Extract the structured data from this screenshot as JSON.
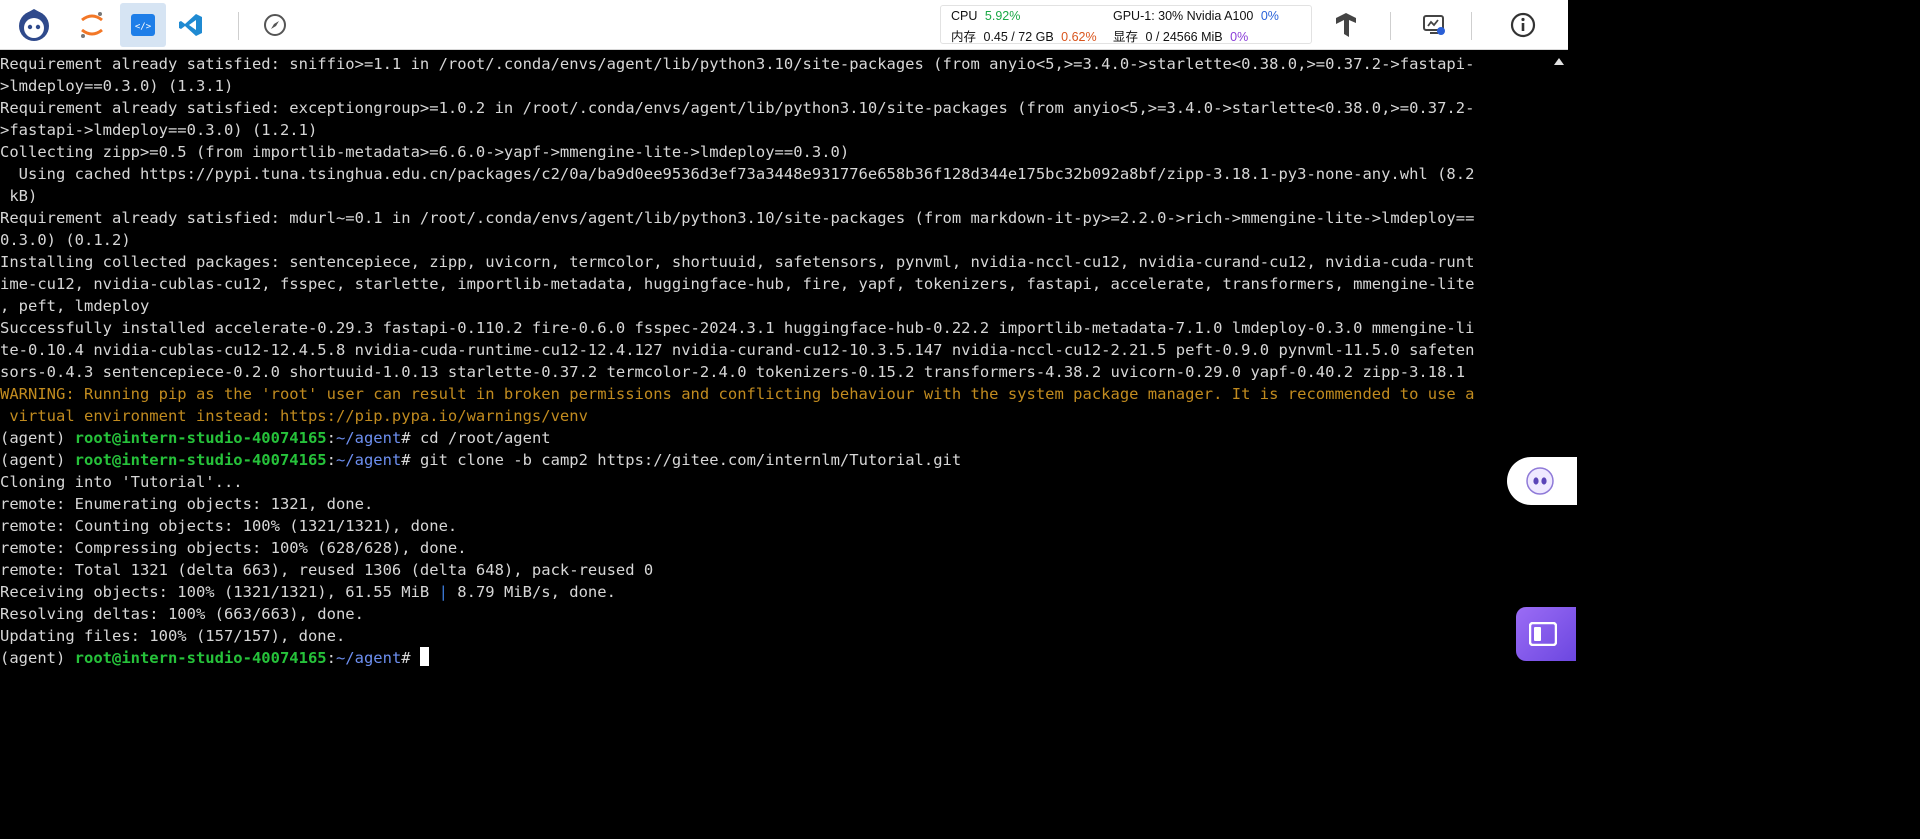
{
  "toolbar": {
    "buttons": [
      {
        "name": "intern-logo-icon"
      },
      {
        "name": "jupyter-icon"
      },
      {
        "name": "code-editor-icon"
      },
      {
        "name": "vscode-icon"
      },
      {
        "name": "compass-icon"
      }
    ],
    "monitor": {
      "cpu_label": "CPU",
      "cpu_value": "5.92%",
      "mem_label": "内存",
      "mem_value": "0.45 / 72 GB",
      "mem_pct": "0.62%",
      "gpu_label": "GPU-1: 30% Nvidia A100",
      "gpu_pct": "0%",
      "vram_label": "显存",
      "vram_value": "0 / 24566 MiB",
      "vram_pct": "0%"
    },
    "right_icons": [
      "tensorflow-icon",
      "monitor-settings-icon",
      "info-icon"
    ]
  },
  "terminal": {
    "plain_lines": [
      "Requirement already satisfied: sniffio>=1.1 in /root/.conda/envs/agent/lib/python3.10/site-packages (from anyio<5,>=3.4.0->starlette<0.38.0,>=0.37.2->fastapi-",
      ">lmdeploy==0.3.0) (1.3.1)",
      "Requirement already satisfied: exceptiongroup>=1.0.2 in /root/.conda/envs/agent/lib/python3.10/site-packages (from anyio<5,>=3.4.0->starlette<0.38.0,>=0.37.2-",
      ">fastapi->lmdeploy==0.3.0) (1.2.1)",
      "Collecting zipp>=0.5 (from importlib-metadata>=6.6.0->yapf->mmengine-lite->lmdeploy==0.3.0)",
      "  Using cached https://pypi.tuna.tsinghua.edu.cn/packages/c2/0a/ba9d0ee9536d3ef73a3448e931776e658b36f128d344e175bc32b092a8bf/zipp-3.18.1-py3-none-any.whl (8.2",
      " kB)",
      "Requirement already satisfied: mdurl~=0.1 in /root/.conda/envs/agent/lib/python3.10/site-packages (from markdown-it-py>=2.2.0->rich->mmengine-lite->lmdeploy==",
      "0.3.0) (0.1.2)",
      "Installing collected packages: sentencepiece, zipp, uvicorn, termcolor, shortuuid, safetensors, pynvml, nvidia-nccl-cu12, nvidia-curand-cu12, nvidia-cuda-runt",
      "ime-cu12, nvidia-cublas-cu12, fsspec, starlette, importlib-metadata, huggingface-hub, fire, yapf, tokenizers, fastapi, accelerate, transformers, mmengine-lite",
      ", peft, lmdeploy",
      "Successfully installed accelerate-0.29.3 fastapi-0.110.2 fire-0.6.0 fsspec-2024.3.1 huggingface-hub-0.22.2 importlib-metadata-7.1.0 lmdeploy-0.3.0 mmengine-li",
      "te-0.10.4 nvidia-cublas-cu12-12.4.5.8 nvidia-cuda-runtime-cu12-12.4.127 nvidia-curand-cu12-10.3.5.147 nvidia-nccl-cu12-2.21.5 peft-0.9.0 pynvml-11.5.0 safeten",
      "sors-0.4.3 sentencepiece-0.2.0 shortuuid-1.0.13 starlette-0.37.2 termcolor-2.4.0 tokenizers-0.15.2 transformers-4.38.2 uvicorn-0.29.0 yapf-0.40.2 zipp-3.18.1"
    ],
    "warning_lines": [
      "WARNING: Running pip as the 'root' user can result in broken permissions and conflicting behaviour with the system package manager. It is recommended to use a",
      " virtual environment instead: https://pip.pypa.io/warnings/venv"
    ],
    "prompt": {
      "env": "(agent) ",
      "user_host": "root@intern-studio-40074165",
      "colon": ":",
      "path": "~/agent",
      "symbol": "# "
    },
    "cmd1": "cd /root/agent",
    "cmd2": "git clone -b camp2 https://gitee.com/internlm/Tutorial.git",
    "output_lines": [
      "Cloning into 'Tutorial'...",
      "remote: Enumerating objects: 1321, done.",
      "remote: Counting objects: 100% (1321/1321), done.",
      "remote: Compressing objects: 100% (628/628), done.",
      "remote: Total 1321 (delta 663), reused 1306 (delta 648), pack-reused 0"
    ],
    "receiving_main": "Receiving objects: 100% (1321/1321), 61.55 MiB ",
    "receiving_bar": "|",
    "receiving_rate": " 8.79 MiB/s, done.",
    "tail_lines": [
      "Resolving deltas: 100% (663/663), done.",
      "Updating files: 100% (157/157), done."
    ]
  }
}
